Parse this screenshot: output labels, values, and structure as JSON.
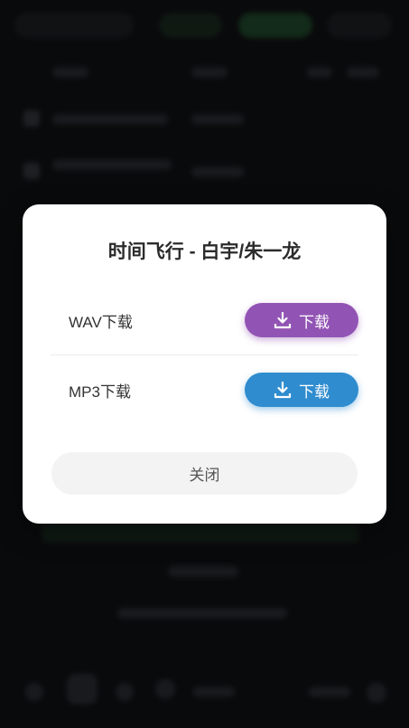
{
  "dialog": {
    "title": "时间飞行 - 白宇/朱一龙",
    "options": [
      {
        "label": "WAV下载",
        "button": "下载",
        "color": "#9254b4"
      },
      {
        "label": "MP3下载",
        "button": "下载",
        "color": "#2f8ccf"
      }
    ],
    "close_label": "关闭"
  }
}
